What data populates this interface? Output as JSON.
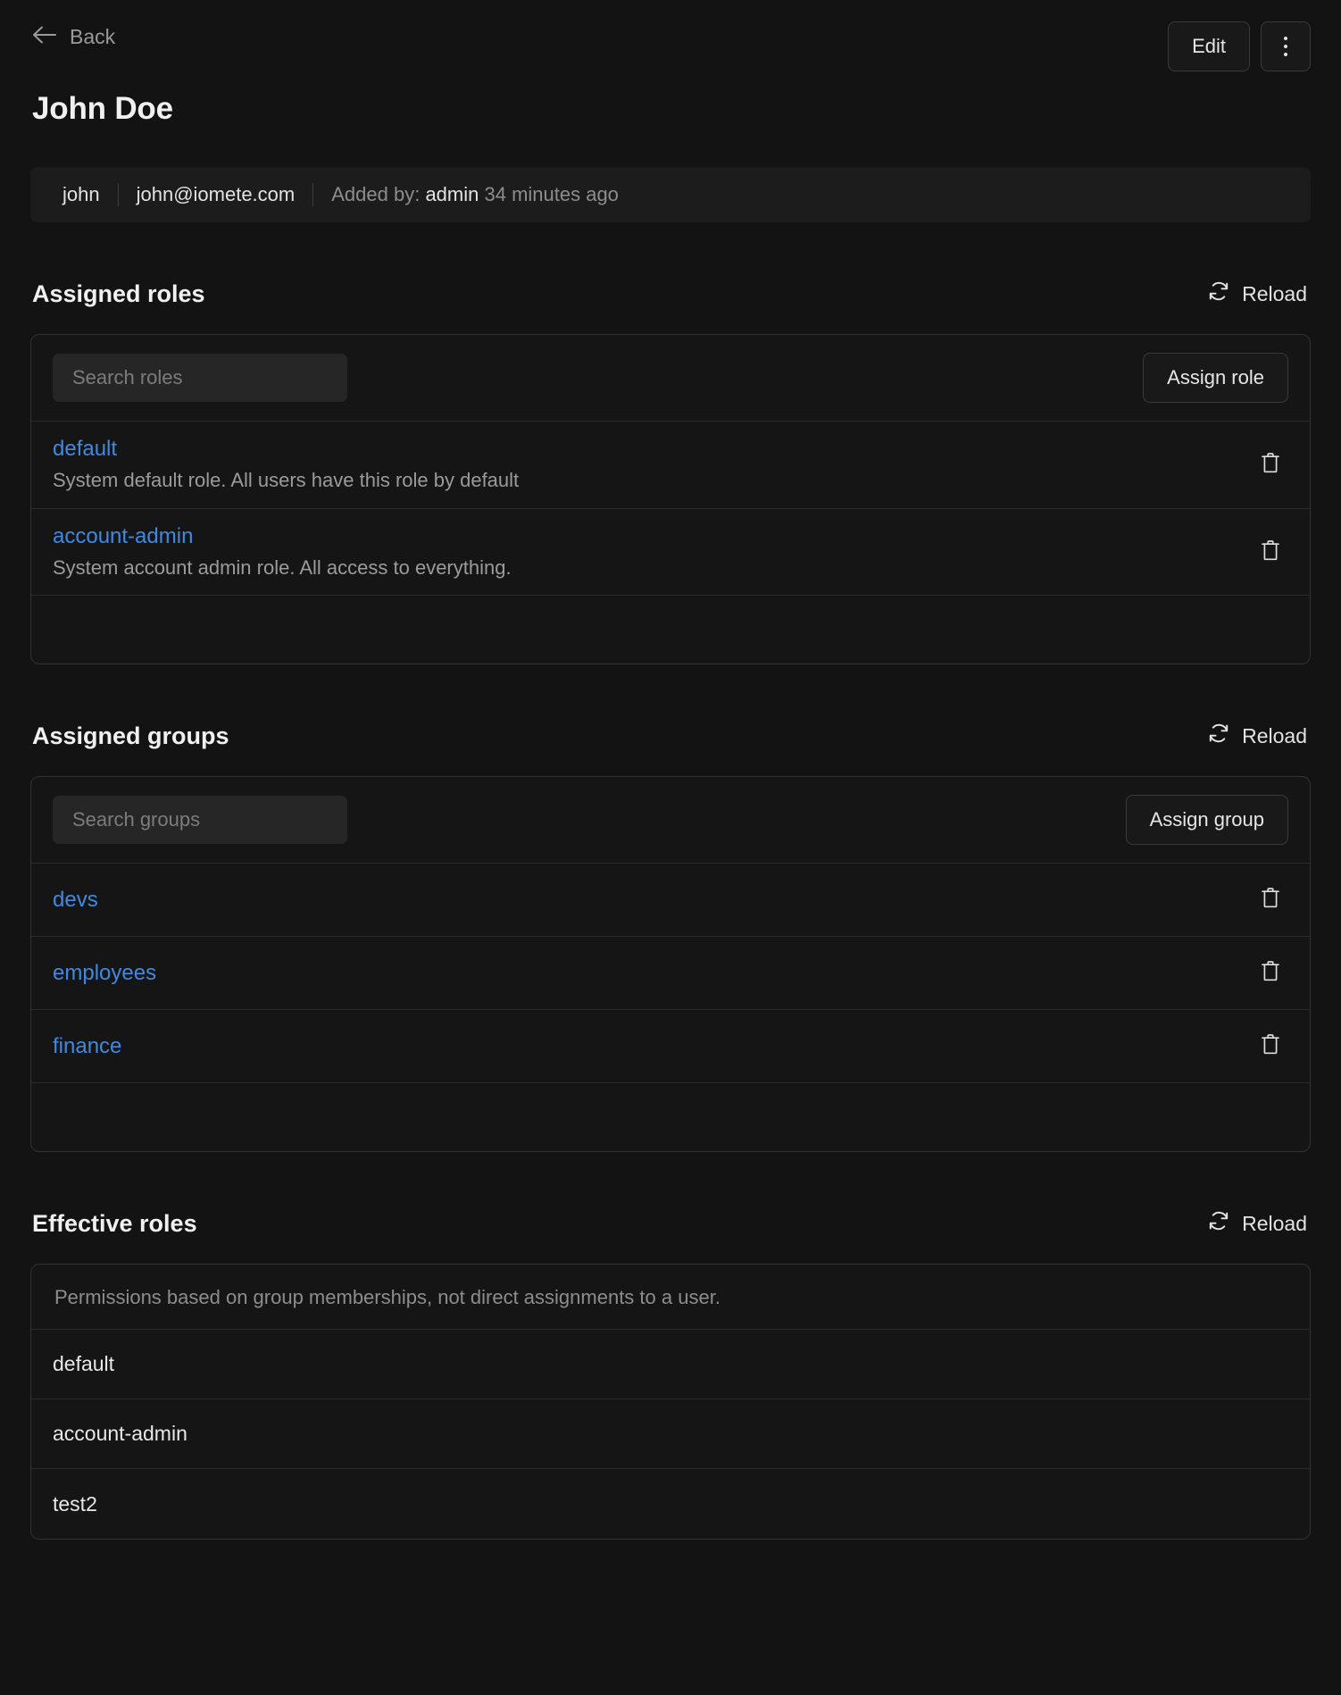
{
  "header": {
    "back_label": "Back",
    "back_icon": "arrow-left-icon",
    "title": "John Doe",
    "edit_label": "Edit",
    "more_icon": "kebab-menu-icon"
  },
  "info_strip": {
    "username": "john",
    "email": "john@iomete.com",
    "added_by_label": "Added by:",
    "added_by_user": "admin",
    "added_time": "34 minutes ago"
  },
  "assigned_roles": {
    "title": "Assigned roles",
    "reload_label": "Reload",
    "reload_icon": "refresh-icon",
    "search_placeholder": "Search roles",
    "search_value": "",
    "assign_label": "Assign role",
    "delete_icon": "trash-icon",
    "rows": [
      {
        "name": "default",
        "description": "System default role. All users have this role by default"
      },
      {
        "name": "account-admin",
        "description": "System account admin role. All access to everything."
      }
    ]
  },
  "assigned_groups": {
    "title": "Assigned groups",
    "reload_label": "Reload",
    "reload_icon": "refresh-icon",
    "search_placeholder": "Search groups",
    "search_value": "",
    "assign_label": "Assign group",
    "delete_icon": "trash-icon",
    "rows": [
      {
        "name": "devs"
      },
      {
        "name": "employees"
      },
      {
        "name": "finance"
      }
    ]
  },
  "effective_roles": {
    "title": "Effective roles",
    "reload_label": "Reload",
    "reload_icon": "refresh-icon",
    "note": "Permissions based on group memberships, not direct assignments to a user.",
    "rows": [
      {
        "name": "default"
      },
      {
        "name": "account-admin"
      },
      {
        "name": "test2"
      }
    ]
  },
  "colors": {
    "background": "#131313",
    "card": "#151515",
    "border": "#323232",
    "link": "#3f8ae0",
    "text": "#f0f0f0",
    "muted": "#8d8d8d"
  }
}
